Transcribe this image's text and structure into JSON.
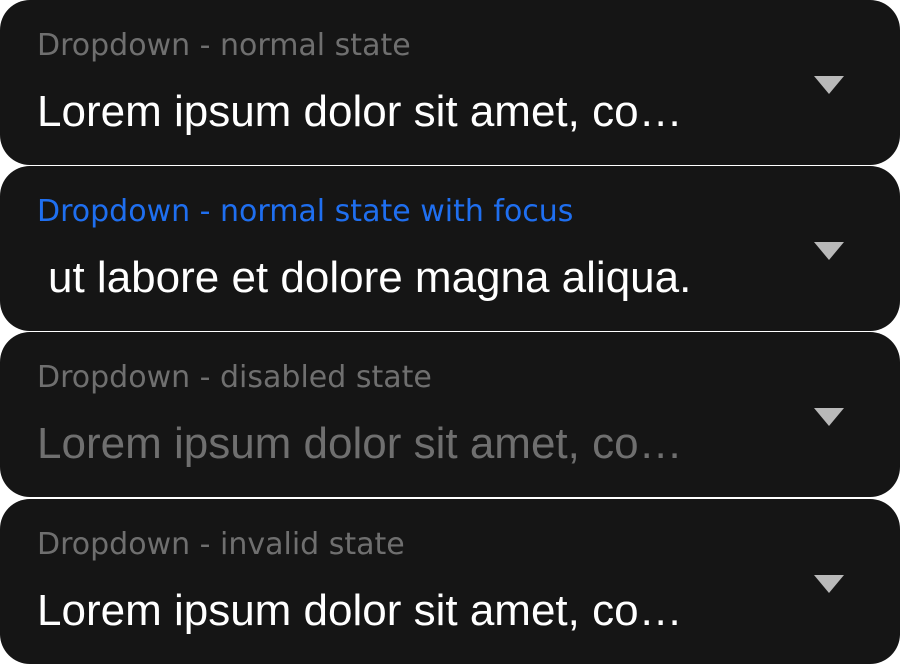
{
  "dropdowns": [
    {
      "label": "Dropdown - normal state",
      "value": "Lorem ipsum dolor sit amet, co…",
      "icon": "chevron-down-icon"
    },
    {
      "label": "Dropdown - normal state with focus",
      "value": "ut labore et dolore magna aliqua.",
      "icon": "chevron-down-icon",
      "label_color": "#1f6ff0"
    },
    {
      "label": "Dropdown - disabled state",
      "value": "Lorem ipsum dolor sit amet, co…",
      "icon": "chevron-down-icon"
    },
    {
      "label": "Dropdown - invalid state",
      "value": "Lorem ipsum dolor sit amet, co…",
      "icon": "chevron-down-icon"
    }
  ],
  "colors": {
    "background": "#151515",
    "label": "#6f6f6f",
    "focus_label": "#1f6ff0",
    "value": "#ffffff",
    "disabled_value": "#6f6f6f",
    "chevron": "#b9b9b9"
  }
}
